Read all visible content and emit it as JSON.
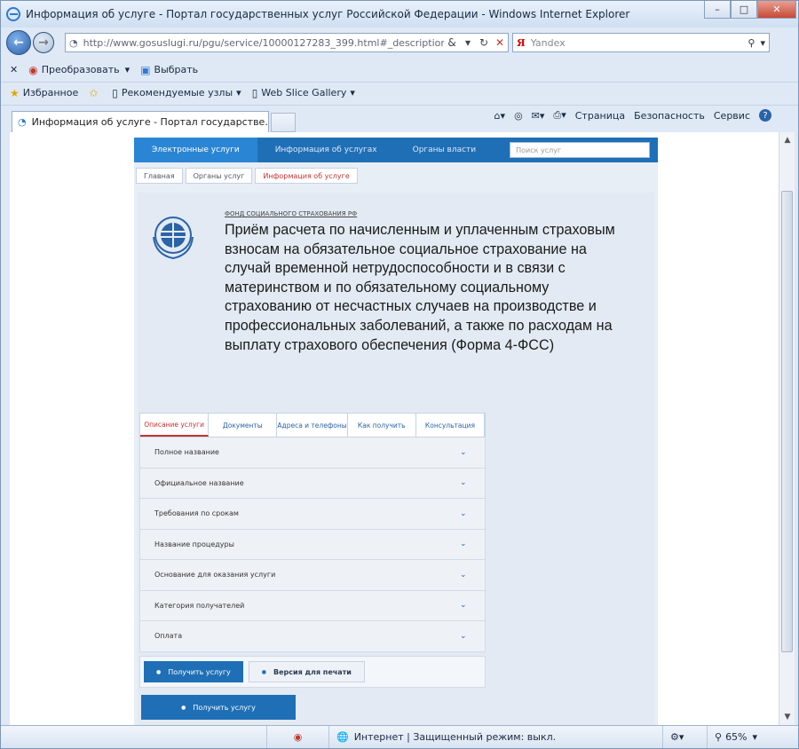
{
  "window": {
    "title": "Информация об услуге - Портал государственных услуг Российской Федерации - Windows Internet Explorer",
    "min_label": "–",
    "max_label": "□",
    "close_label": "✕"
  },
  "address": {
    "url": "http://www.gosuslugi.ru/pgu/service/10000127283_399.html#_description",
    "search_placeholder": "Yandex",
    "yandex_logo": "Я"
  },
  "commandbar": {
    "close": "✕",
    "convert_label": "Преобразовать",
    "select_label": "Выбрать"
  },
  "favorites": {
    "favorites_label": "Избранное",
    "suggested_label": "Рекомендуемые узлы",
    "webslice_label": "Web Slice Gallery"
  },
  "tabs": {
    "active_tab": "Информация об услуге - Портал государстве..."
  },
  "toolbar": {
    "page_label": "Страница",
    "security_label": "Безопасность",
    "service_label": "Сервис",
    "help_label": "?"
  },
  "portal": {
    "nav": [
      "Электронные услуги",
      "Информация об услугах",
      "Органы власти"
    ],
    "search_placeholder": "Поиск услуг",
    "crumbs": [
      "Главная",
      "Органы услуг",
      "Информация об услуге"
    ],
    "org_link": "ФОНД СОЦИАЛЬНОГО СТРАХОВАНИЯ РФ",
    "heading": "Приём расчета по начисленным и уплаченным страховым взносам на обязательное социальное страхование на случай временной нетрудоспособности и в связи с материнством и по обязательному социальному страхованию от несчастных случаев на производстве и профессиональных заболеваний, а также по расходам на выплату страхового обеспечения (Форма 4-ФСС)",
    "service_tabs": [
      "Описание услуги",
      "Документы",
      "Адреса и телефоны",
      "Как получить",
      "Консультация"
    ],
    "sections": [
      "Полное название",
      "Официальное название",
      "Требования по срокам",
      "Название процедуры",
      "Основание для оказания услуги",
      "Категория получателей",
      "Оплата"
    ],
    "get_service_label": "Получить услугу",
    "print_version_label": "Версия для печати",
    "get_service_big_label": "Получить услугу"
  },
  "statusbar": {
    "zone_label": "Интернет | Защищенный режим: выкл.",
    "zoom": "65%"
  }
}
